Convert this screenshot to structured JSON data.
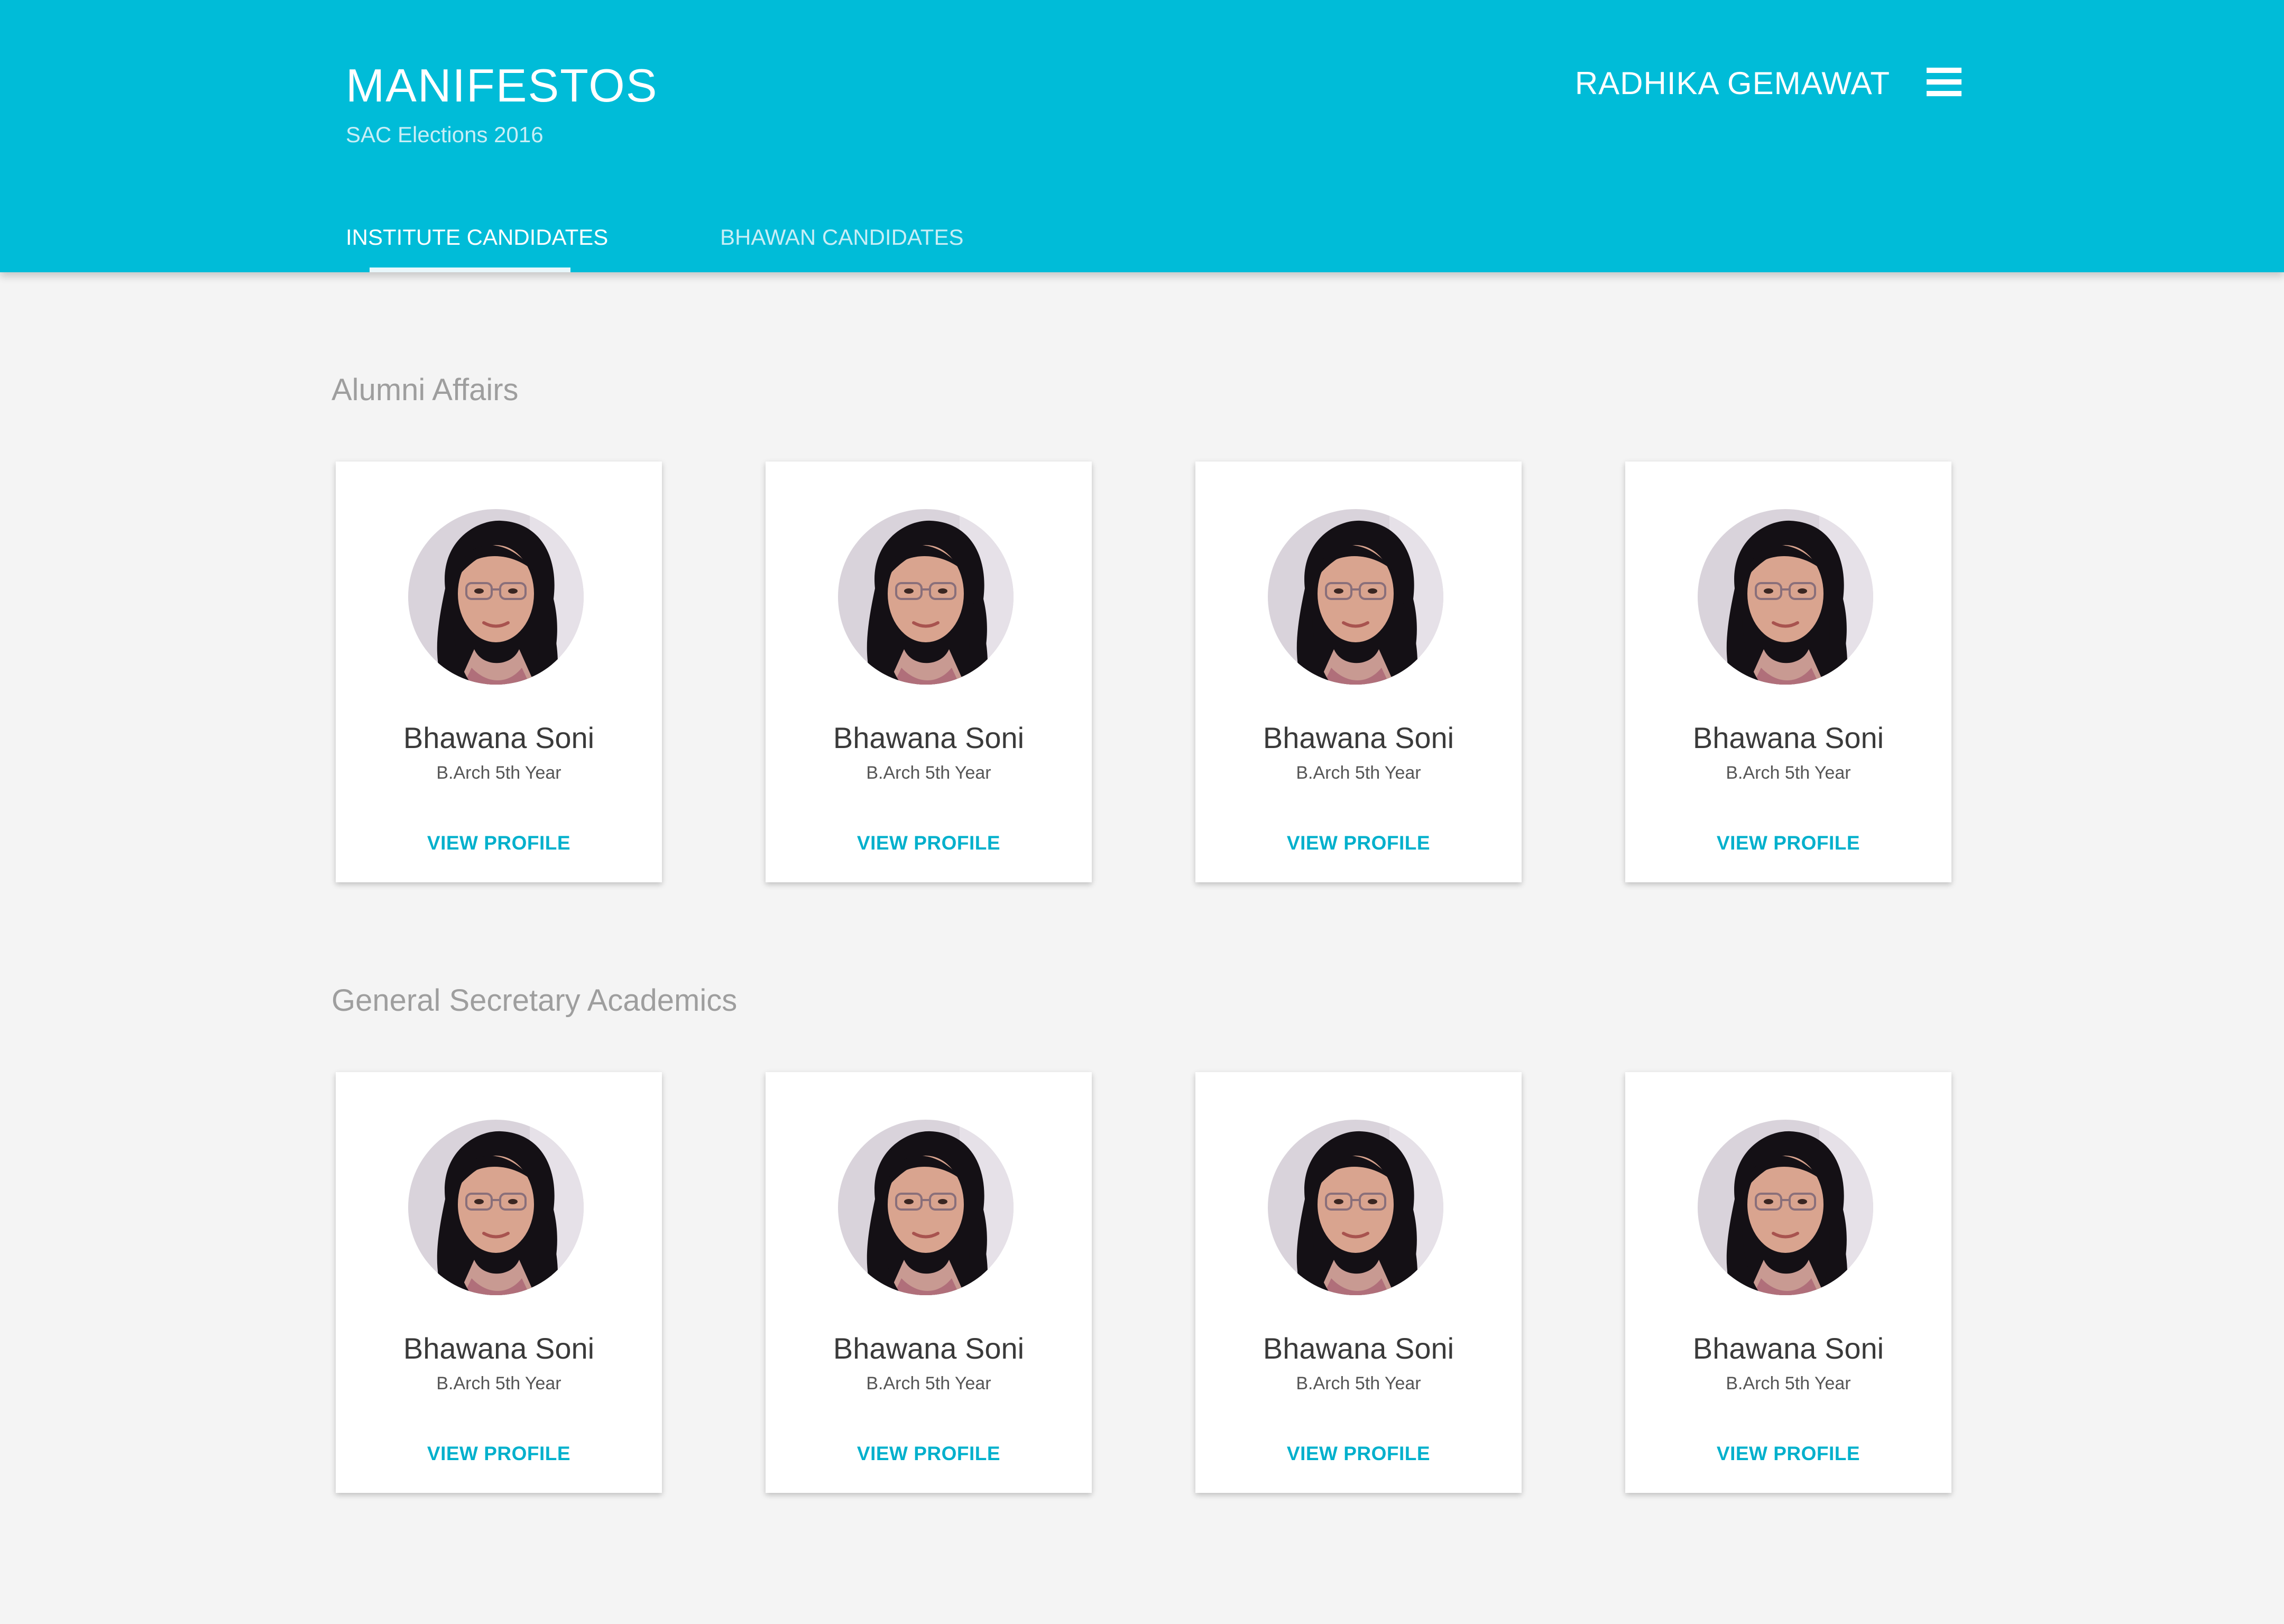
{
  "header": {
    "title": "MANIFESTOS",
    "subtitle": "SAC Elections 2016",
    "user_name": "RADHIKA GEMAWAT",
    "menu_icon": "hamburger-menu-icon",
    "background_color": "#00bcd8"
  },
  "tabs": [
    {
      "label": "INSTITUTE CANDIDATES",
      "active": true
    },
    {
      "label": "BHAWAN CANDIDATES",
      "active": false
    }
  ],
  "sections": [
    {
      "title": "Alumni Affairs",
      "candidates": [
        {
          "name": "Bhawana Soni",
          "year": "B.Arch 5th Year",
          "action": "VIEW PROFILE"
        },
        {
          "name": "Bhawana Soni",
          "year": "B.Arch 5th Year",
          "action": "VIEW PROFILE"
        },
        {
          "name": "Bhawana Soni",
          "year": "B.Arch 5th Year",
          "action": "VIEW PROFILE"
        },
        {
          "name": "Bhawana Soni",
          "year": "B.Arch 5th Year",
          "action": "VIEW PROFILE"
        }
      ]
    },
    {
      "title": "General Secretary Academics",
      "candidates": [
        {
          "name": "Bhawana Soni",
          "year": "B.Arch 5th Year",
          "action": "VIEW PROFILE"
        },
        {
          "name": "Bhawana Soni",
          "year": "B.Arch 5th Year",
          "action": "VIEW PROFILE"
        },
        {
          "name": "Bhawana Soni",
          "year": "B.Arch 5th Year",
          "action": "VIEW PROFILE"
        },
        {
          "name": "Bhawana Soni",
          "year": "B.Arch 5th Year",
          "action": "VIEW PROFILE"
        }
      ]
    }
  ],
  "colors": {
    "accent": "#00bcd8",
    "link": "#00b0cc",
    "page_background": "#f4f4f4"
  }
}
